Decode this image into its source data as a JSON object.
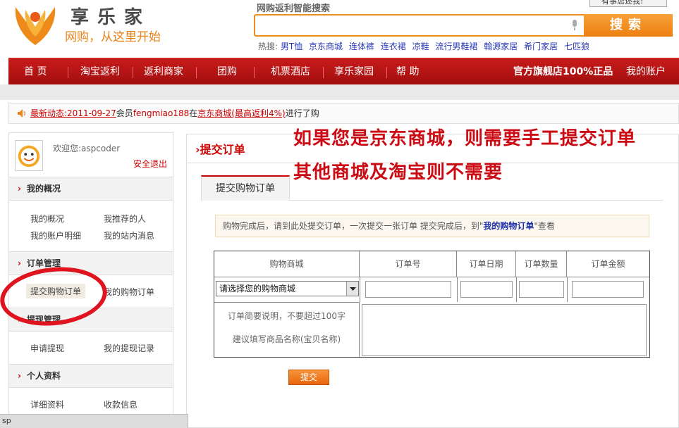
{
  "header": {
    "logo_name": "享乐家",
    "logo_slogan": "网购，从这里开始",
    "search_title": "网购返利智能搜索",
    "search_value": "",
    "search_button": "搜索",
    "hot_label": "热搜:",
    "hot_keywords": [
      "男T恤",
      "京东商城",
      "连体裤",
      "连衣裙",
      "凉鞋",
      "流行男鞋裙",
      "翰源家居",
      "希门家居",
      "七匹狼"
    ],
    "top_badge": "有事您述我!"
  },
  "nav": {
    "items": [
      "首 页",
      "淘宝返利",
      "返利商家",
      "团购",
      "机票酒店",
      "享乐家园",
      "帮 助"
    ],
    "promo": "官方旗舰店100%正品",
    "account": "我的账户"
  },
  "news": {
    "label": "最新动态:",
    "date": "2011-09-27",
    "pre_user": "会员",
    "user": "fengmiao188",
    "mid": "在",
    "store": "京东商城(最高返利4%)",
    "suffix": "进行了购"
  },
  "sidebar": {
    "welcome": "欢迎您:aspcoder",
    "logout": "安全退出",
    "sections": [
      {
        "title": "我的概况",
        "links": [
          "我的概况",
          "我推荐的人",
          "我的账户明细",
          "我的站内消息"
        ]
      },
      {
        "title": "订单管理",
        "links": [
          "提交购物订单",
          "我的购物订单"
        ]
      },
      {
        "title": "提现管理",
        "links": [
          "申请提现",
          "我的提现记录"
        ]
      },
      {
        "title": "个人资料",
        "links": [
          "详细资料",
          "收款信息"
        ]
      }
    ]
  },
  "main": {
    "title": "提交订单",
    "tab": "提交购物订单",
    "tip_prefix": "购物完成后，请到此处提交订单，一次提交一张订单 提交完成后，到",
    "tip_link": "我的购物订单",
    "tip_suffix": "查看",
    "columns": [
      "购物商城",
      "订单号",
      "订单日期",
      "订单数量",
      "订单金额"
    ],
    "select_value": "请选择您的购物商城",
    "desc_line1": "订单简要说明，不要超过100字",
    "desc_line2": "建议填写商品名称(宝贝名称)",
    "submit": "提交"
  },
  "overlay": {
    "line1": "如果您是京东商城，则需要手工提交订单",
    "line2": "其他商城及淘宝则不需要"
  },
  "statusbar": {
    "text": "sp"
  },
  "colors": {
    "brand_red": "#cc0000",
    "accent_orange": "#f18d1a",
    "link_blue": "#2a3bb8"
  }
}
